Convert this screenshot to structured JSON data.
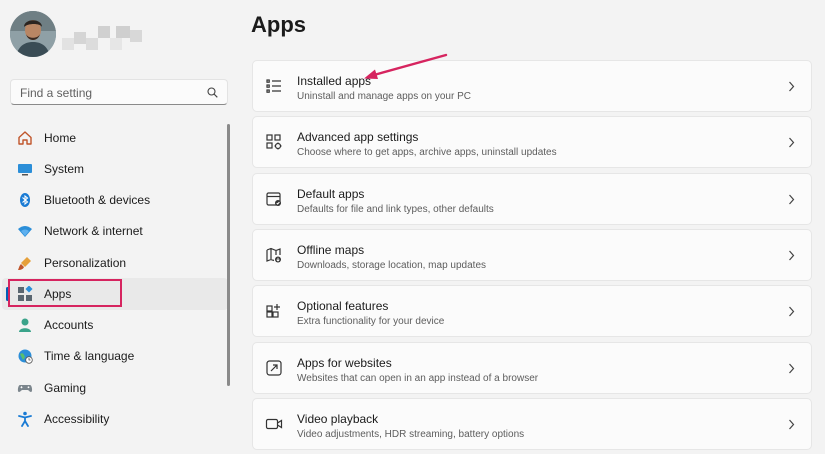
{
  "sidebar": {
    "search": {
      "placeholder": "Find a setting",
      "value": ""
    },
    "items": [
      {
        "label": "Home",
        "icon": "home-icon",
        "active": false
      },
      {
        "label": "System",
        "icon": "system-icon",
        "active": false
      },
      {
        "label": "Bluetooth & devices",
        "icon": "bluetooth-icon",
        "active": false
      },
      {
        "label": "Network & internet",
        "icon": "wifi-icon",
        "active": false
      },
      {
        "label": "Personalization",
        "icon": "brush-icon",
        "active": false
      },
      {
        "label": "Apps",
        "icon": "apps-icon",
        "active": true
      },
      {
        "label": "Accounts",
        "icon": "account-icon",
        "active": false
      },
      {
        "label": "Time & language",
        "icon": "globe-icon",
        "active": false
      },
      {
        "label": "Gaming",
        "icon": "gamepad-icon",
        "active": false
      },
      {
        "label": "Accessibility",
        "icon": "accessibility-icon",
        "active": false
      }
    ]
  },
  "main": {
    "title": "Apps",
    "cards": [
      {
        "title": "Installed apps",
        "subtitle": "Uninstall and manage apps on your PC",
        "icon": "list-icon"
      },
      {
        "title": "Advanced app settings",
        "subtitle": "Choose where to get apps, archive apps, uninstall updates",
        "icon": "app-settings-icon"
      },
      {
        "title": "Default apps",
        "subtitle": "Defaults for file and link types, other defaults",
        "icon": "default-apps-icon"
      },
      {
        "title": "Offline maps",
        "subtitle": "Downloads, storage location, map updates",
        "icon": "map-icon"
      },
      {
        "title": "Optional features",
        "subtitle": "Extra functionality for your device",
        "icon": "optional-features-icon"
      },
      {
        "title": "Apps for websites",
        "subtitle": "Websites that can open in an app instead of a browser",
        "icon": "open-external-icon"
      },
      {
        "title": "Video playback",
        "subtitle": "Video adjustments, HDR streaming, battery options",
        "icon": "video-icon"
      }
    ]
  },
  "colors": {
    "accent": "#005fb8",
    "annotation": "#d6245f",
    "background": "#f3f3f3",
    "card": "#fbfbfb"
  }
}
